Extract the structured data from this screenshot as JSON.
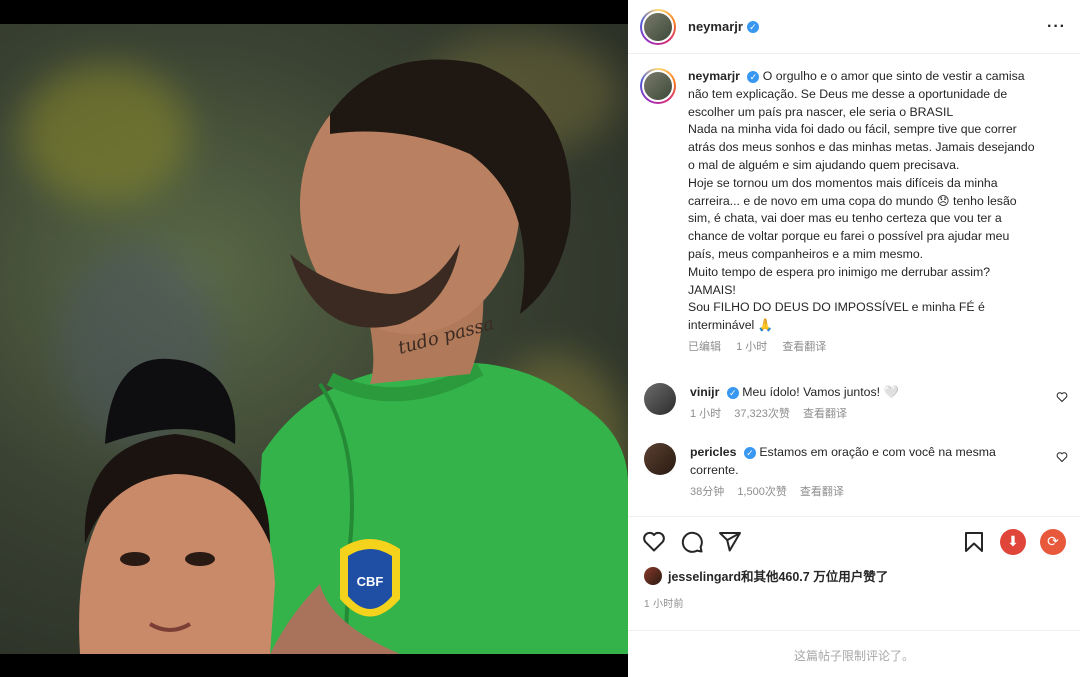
{
  "post": {
    "author": "neymarjr",
    "more_icon": "more-horizontal-icon",
    "caption_lines": [
      "O orgulho e o amor que sinto de vestir a camisa",
      "não tem explicação. Se Deus me desse a oportunidade de",
      "escolher um país pra nascer, ele seria o BRASIL",
      "Nada na minha vida foi dado ou fácil, sempre tive que correr",
      "atrás dos meus sonhos e das minhas metas. Jamais desejando",
      "o mal de alguém e sim ajudando quem precisava.",
      "Hoje se tornou um dos momentos mais difíceis da minha",
      "carreira... e de novo em uma copa do mundo 😞 tenho lesão",
      "sim, é chata, vai doer mas eu tenho certeza que vou ter a",
      "chance de voltar porque eu farei o possível pra ajudar meu",
      "país, meus companheiros e a mim mesmo.",
      "Muito tempo de espera pro inimigo me derrubar assim?",
      "JAMAIS!",
      "Sou FILHO DO DEUS DO IMPOSSÍVEL e minha FÉ é",
      "interminável 🙏"
    ],
    "caption_meta": {
      "edited": "已编辑",
      "time": "1 小时",
      "translate": "查看翻译"
    }
  },
  "comments": [
    {
      "user": "vinijr",
      "text": "Meu ídolo! Vamos juntos! 🤍",
      "time": "1 小时",
      "likes": "37,323次赞",
      "translate": "查看翻译"
    },
    {
      "user": "pericles",
      "text": "Estamos em oração e com você na mesma",
      "text2": "corrente.",
      "time": "38分钟",
      "likes": "1,500次赞",
      "translate": "查看翻译"
    }
  ],
  "likes": {
    "text": "jesselingard和其他460.7 万位用户赞了"
  },
  "time_ago": "1 小时前",
  "comments_limited": "这篇帖子限制评论了。",
  "colors": {
    "verified": "#3897f0",
    "download": "#e0453a",
    "refresh": "#e8583b",
    "jersey": "#34b34a"
  }
}
